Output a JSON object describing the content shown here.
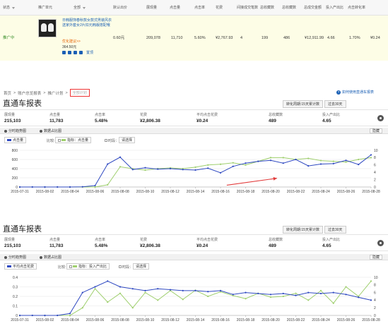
{
  "table": {
    "headers": {
      "status": "状态",
      "unit": "推广单元",
      "all": "全部",
      "default_bid": "默认出价",
      "impressions": "展现量",
      "clicks": "点击量",
      "ctr": "点击率",
      "cost": "花费",
      "indirect": "间接成交笔数",
      "total_fav": "总收藏数",
      "total_fav2": "总收藏数",
      "total_deal": "总成交金额",
      "roi": "投入产出比",
      "cvr": "点击转化率"
    },
    "row": {
      "status": "推广中",
      "product_title": "日韩服饰春秋款女款式男装风衣送家外套女2片扣元韩版搭配哦",
      "advice": "优化建议>>",
      "bid": "364.50元",
      "cart_label": "置顶",
      "default_bid": "0.60元",
      "impressions": "209,078",
      "clicks": "11,710",
      "ctr": "5.60%",
      "cost": "¥2,767.93",
      "indirect": "4",
      "total_fav": "199",
      "total_fav2": "486",
      "total_deal": "¥12,911.99",
      "roi": "4.66",
      "cvr": "1.70%",
      "cvr2": "¥0.24"
    }
  },
  "breadcrumb": {
    "home": "首页",
    "sep1": ">",
    "account": "账户总览报表",
    "sep2": ">",
    "plan": "推广计划",
    "sep3": ">",
    "select_placeholder": "全部计划"
  },
  "help_link": "如何使用直通车报表",
  "help_icon_text": "?",
  "report1": {
    "title": "直通车报表",
    "conversion_period": "转化周期:15天累计数",
    "range": "过去30天",
    "metrics": [
      {
        "label": "展现量",
        "value": "215,103"
      },
      {
        "label": "点击量",
        "value": "11,783"
      },
      {
        "label": "点击率",
        "value": "5.48%"
      },
      {
        "label": "花费",
        "value": "¥2,806.38"
      },
      {
        "label": "平均点击花费",
        "value": "¥0.24"
      },
      {
        "label": "总收藏数",
        "value": "489"
      },
      {
        "label": "投入产出比",
        "value": "4.65"
      }
    ],
    "tab_trend": "分时趋势图",
    "tab_compare": "数据占比图",
    "hide": "隐藏",
    "metric_select": "点击量",
    "compare_label": "比较:",
    "compare_select": "指标：点击量",
    "time_label": "时段：",
    "time_select": "请选择"
  },
  "report2": {
    "title": "直通车报表",
    "conversion_period": "转化周期:15天累计数",
    "range": "过去30天",
    "metrics": [
      {
        "label": "展现量",
        "value": "215,103"
      },
      {
        "label": "点击量",
        "value": "11,783"
      },
      {
        "label": "点击率",
        "value": "5.48%"
      },
      {
        "label": "花费",
        "value": "¥2,806.38"
      },
      {
        "label": "平均点击花费",
        "value": "¥0.24"
      },
      {
        "label": "总收藏数",
        "value": "489"
      },
      {
        "label": "投入产出比",
        "value": "4.65"
      }
    ],
    "tab_trend": "分时趋势图",
    "tab_compare": "数据占比图",
    "hide": "隐藏",
    "metric_select": "平均点击花费",
    "compare_label": "比较:",
    "compare_select": "指标：投入产出比",
    "time_label": "时段：",
    "time_select": "请选择"
  },
  "chart_data": [
    {
      "type": "line",
      "x": [
        "2015-07-31",
        "2015-08-01",
        "2015-08-02",
        "2015-08-03",
        "2015-08-04",
        "2015-08-05",
        "2015-08-06",
        "2015-08-07",
        "2015-08-08",
        "2015-08-09",
        "2015-08-10",
        "2015-08-11",
        "2015-08-12",
        "2015-08-13",
        "2015-08-14",
        "2015-08-15",
        "2015-08-16",
        "2015-08-17",
        "2015-08-18",
        "2015-08-19",
        "2015-08-20",
        "2015-08-21",
        "2015-08-22",
        "2015-08-23",
        "2015-08-24",
        "2015-08-25",
        "2015-08-26",
        "2015-08-27",
        "2015-08-28"
      ],
      "x_tick_labels": [
        "2015-07-31",
        "2015-08-02",
        "2015-08-04",
        "2015-08-06",
        "2015-08-08",
        "2015-08-10",
        "2015-08-12",
        "2015-08-14",
        "2015-08-16",
        "2015-08-18",
        "2015-08-20",
        "2015-08-22",
        "2015-08-24",
        "2015-08-26",
        "2015-08-28"
      ],
      "series": [
        {
          "name": "点击量",
          "color": "#2f49c1",
          "axis": "left",
          "values": [
            0,
            0,
            0,
            0,
            0,
            5,
            30,
            500,
            650,
            380,
            420,
            390,
            400,
            380,
            370,
            410,
            310,
            450,
            520,
            560,
            580,
            520,
            600,
            460,
            500,
            510,
            580,
            490,
            700
          ]
        },
        {
          "name": "点击量(比较)",
          "color": "#9fcf6e",
          "axis": "right",
          "values": [
            0,
            0,
            0,
            0,
            0,
            0,
            0,
            0.6,
            5.5,
            5.0,
            4.6,
            5.0,
            5.2,
            5.0,
            5.4,
            6.0,
            6.2,
            6.6,
            6.0,
            7.0,
            8.0,
            8.0,
            7.5,
            7.8,
            7.2,
            7.0,
            6.8,
            7.5,
            8.0
          ]
        }
      ],
      "ylim_left": [
        0,
        800
      ],
      "yticks_left": [
        0,
        200,
        400,
        600,
        800
      ],
      "ylim_right": [
        0,
        10
      ],
      "yticks_right": [
        0,
        2,
        4,
        6,
        8,
        10
      ],
      "annotation": "arrow",
      "grid": true
    },
    {
      "type": "line",
      "x": [
        "2015-07-31",
        "2015-08-01",
        "2015-08-02",
        "2015-08-03",
        "2015-08-04",
        "2015-08-05",
        "2015-08-06",
        "2015-08-07",
        "2015-08-08",
        "2015-08-09",
        "2015-08-10",
        "2015-08-11",
        "2015-08-12",
        "2015-08-13",
        "2015-08-14",
        "2015-08-15",
        "2015-08-16",
        "2015-08-17",
        "2015-08-18",
        "2015-08-19",
        "2015-08-20",
        "2015-08-21",
        "2015-08-22",
        "2015-08-23",
        "2015-08-24",
        "2015-08-25",
        "2015-08-26",
        "2015-08-27",
        "2015-08-28"
      ],
      "x_tick_labels": [
        "2015-07-31",
        "2015-08-02",
        "2015-08-04",
        "2015-08-06",
        "2015-08-08",
        "2015-08-10",
        "2015-08-12",
        "2015-08-14",
        "2015-08-16",
        "2015-08-18",
        "2015-08-20",
        "2015-08-22",
        "2015-08-24",
        "2015-08-26",
        "2015-08-28"
      ],
      "series": [
        {
          "name": "平均点击花费",
          "color": "#2f49c1",
          "axis": "left",
          "values": [
            0,
            0,
            0,
            0,
            0.02,
            0.24,
            0.3,
            0.36,
            0.3,
            0.28,
            0.26,
            0.28,
            0.27,
            0.26,
            0.26,
            0.25,
            0.26,
            0.22,
            0.24,
            0.23,
            0.22,
            0.23,
            0.21,
            0.24,
            0.23,
            0.24,
            0.22,
            0.19,
            0.16
          ]
        },
        {
          "name": "投入产出比",
          "color": "#9fcf6e",
          "axis": "right",
          "values": [
            0,
            0,
            0,
            0,
            0,
            2.0,
            7.0,
            3.5,
            5.8,
            2.0,
            6.0,
            4.0,
            6.5,
            4.2,
            6.6,
            5.0,
            6.2,
            5.2,
            4.4,
            5.8,
            4.8,
            5.0,
            5.8,
            4.0,
            6.5,
            3.2,
            7.5,
            5.0,
            9.0
          ]
        }
      ],
      "ylim_left": [
        0,
        0.4
      ],
      "yticks_left": [
        0,
        0.1,
        0.2,
        0.3,
        0.4
      ],
      "ylim_right": [
        0,
        10
      ],
      "yticks_right": [
        0,
        2,
        4,
        6,
        8,
        10
      ],
      "grid": true
    }
  ]
}
